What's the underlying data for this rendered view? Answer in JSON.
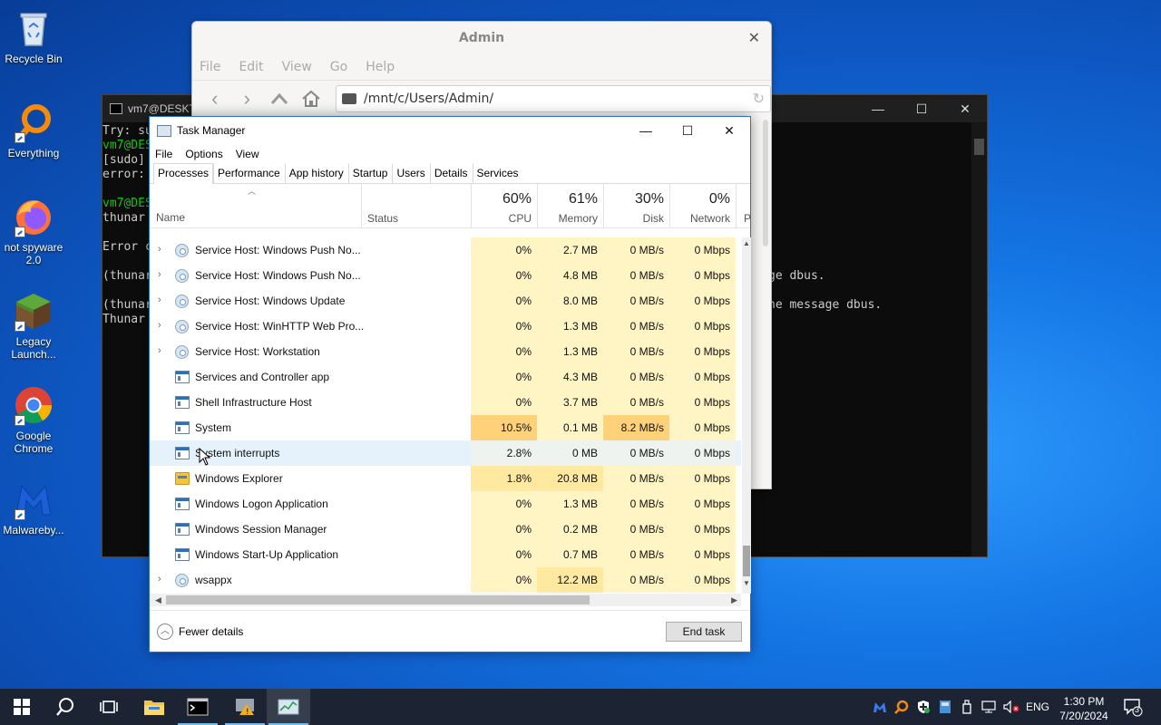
{
  "desktop": {
    "icons": [
      {
        "label": "Recycle Bin"
      },
      {
        "label": "Everything"
      },
      {
        "label": "not spyware 2.0"
      },
      {
        "label": "Legacy Launch..."
      },
      {
        "label": "Google Chrome"
      },
      {
        "label": "Malwareby..."
      }
    ]
  },
  "terminal": {
    "title": "vm7@DESKT",
    "lines": [
      {
        "text": "Try: su",
        "color": "gray"
      },
      {
        "text": "vm7@DES",
        "color": "green"
      },
      {
        "text": "[sudo]",
        "color": "gray"
      },
      {
        "text": "error:",
        "color": "gray"
      },
      {
        "text": "vm7@DES",
        "color": "green"
      },
      {
        "text": "thunar",
        "color": "gray"
      },
      {
        "text": "Error c",
        "color": "gray"
      },
      {
        "text": "(thunar",
        "color": "gray"
      },
      {
        "text": "(thunar",
        "color": "gray"
      },
      {
        "text": "Thunar",
        "color": "gray"
      }
    ],
    "right_lines": [
      "ge dbus.",
      "he message dbus."
    ]
  },
  "thunar": {
    "title": "Admin",
    "menu": [
      "File",
      "Edit",
      "View",
      "Go",
      "Help"
    ],
    "path": "/mnt/c/Users/Admin/"
  },
  "task_manager": {
    "title": "Task Manager",
    "menu": [
      "File",
      "Options",
      "View"
    ],
    "tabs": [
      "Processes",
      "Performance",
      "App history",
      "Startup",
      "Users",
      "Details",
      "Services"
    ],
    "active_tab": "Processes",
    "columns": {
      "name": "Name",
      "status": "Status",
      "cpu": {
        "pct": "60%",
        "label": "CPU"
      },
      "memory": {
        "pct": "61%",
        "label": "Memory"
      },
      "disk": {
        "pct": "30%",
        "label": "Disk"
      },
      "network": {
        "pct": "0%",
        "label": "Network"
      },
      "power_cut": "P"
    },
    "processes": [
      {
        "name": "Service Host: Windows Push No...",
        "icon": "gear",
        "expandable": true,
        "cpu": "0%",
        "memory": "2.7 MB",
        "disk": "0 MB/s",
        "network": "0 Mbps"
      },
      {
        "name": "Service Host: Windows Push No...",
        "icon": "gear",
        "expandable": true,
        "cpu": "0%",
        "memory": "4.8 MB",
        "disk": "0 MB/s",
        "network": "0 Mbps"
      },
      {
        "name": "Service Host: Windows Update",
        "icon": "gear",
        "expandable": true,
        "cpu": "0%",
        "memory": "8.0 MB",
        "disk": "0 MB/s",
        "network": "0 Mbps"
      },
      {
        "name": "Service Host: WinHTTP Web Pro...",
        "icon": "gear",
        "expandable": true,
        "cpu": "0%",
        "memory": "1.3 MB",
        "disk": "0 MB/s",
        "network": "0 Mbps"
      },
      {
        "name": "Service Host: Workstation",
        "icon": "gear",
        "expandable": true,
        "cpu": "0%",
        "memory": "1.3 MB",
        "disk": "0 MB/s",
        "network": "0 Mbps"
      },
      {
        "name": "Services and Controller app",
        "icon": "app",
        "expandable": false,
        "cpu": "0%",
        "memory": "4.3 MB",
        "disk": "0 MB/s",
        "network": "0 Mbps"
      },
      {
        "name": "Shell Infrastructure Host",
        "icon": "app",
        "expandable": false,
        "cpu": "0%",
        "memory": "3.7 MB",
        "disk": "0 MB/s",
        "network": "0 Mbps"
      },
      {
        "name": "System",
        "icon": "app",
        "expandable": false,
        "cpu": "10.5%",
        "memory": "0.1 MB",
        "disk": "8.2 MB/s",
        "network": "0 Mbps"
      },
      {
        "name": "System interrupts",
        "icon": "app",
        "expandable": false,
        "cpu": "2.8%",
        "memory": "0 MB",
        "disk": "0 MB/s",
        "network": "0 Mbps"
      },
      {
        "name": "Windows Explorer",
        "icon": "folder",
        "expandable": false,
        "cpu": "1.8%",
        "memory": "20.8 MB",
        "disk": "0 MB/s",
        "network": "0 Mbps"
      },
      {
        "name": "Windows Logon Application",
        "icon": "app",
        "expandable": false,
        "cpu": "0%",
        "memory": "1.3 MB",
        "disk": "0 MB/s",
        "network": "0 Mbps"
      },
      {
        "name": "Windows Session Manager",
        "icon": "app",
        "expandable": false,
        "cpu": "0%",
        "memory": "0.2 MB",
        "disk": "0 MB/s",
        "network": "0 Mbps"
      },
      {
        "name": "Windows Start-Up Application",
        "icon": "app",
        "expandable": false,
        "cpu": "0%",
        "memory": "0.7 MB",
        "disk": "0 MB/s",
        "network": "0 Mbps"
      },
      {
        "name": "wsappx",
        "icon": "gear",
        "expandable": true,
        "cpu": "0%",
        "memory": "12.2 MB",
        "disk": "0 MB/s",
        "network": "0 Mbps"
      }
    ],
    "fewer_details": "Fewer details",
    "end_task": "End task"
  },
  "taskbar": {
    "tray_language": "ENG",
    "time": "1:30 PM",
    "date": "7/20/2024",
    "notification_count": "3"
  },
  "colors": {
    "heat_light": "#fff4c4",
    "heat_mid": "#ffe9a0",
    "heat_strong": "#ffd27a",
    "taskbar": "#1c2433",
    "accent": "#76b9ed"
  }
}
